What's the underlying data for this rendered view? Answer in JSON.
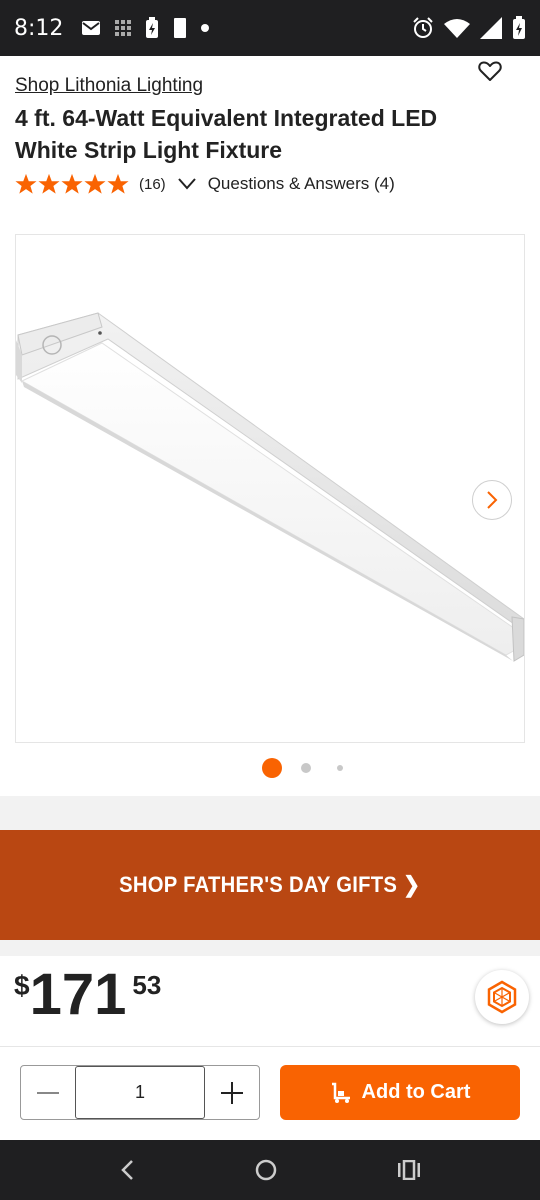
{
  "status_bar": {
    "time": "8:12",
    "left_icons": [
      "mail-icon",
      "grid-icon",
      "battery-saver-icon",
      "sd-card-icon",
      "dot-icon"
    ],
    "right_icons": [
      "alarm-icon",
      "wifi-icon",
      "signal-icon",
      "battery-icon"
    ]
  },
  "product": {
    "brand_link": "Shop Lithonia Lighting",
    "title": "4 ft. 64-Watt Equivalent Integrated LED White Strip Light Fixture",
    "rating": 5,
    "review_count": "(16)",
    "qa_label": "Questions & Answers (4)"
  },
  "gallery": {
    "image_count": 3,
    "active_index": 0
  },
  "promo": {
    "label": "SHOP FATHER'S DAY GIFTS ❯"
  },
  "price": {
    "currency": "$",
    "dollars": "171",
    "cents": "53"
  },
  "cart": {
    "quantity": "1",
    "add_label": "Add to Cart"
  },
  "colors": {
    "accent": "#f96302",
    "promo_bg": "#b94712",
    "system_bar": "#1f1f21"
  }
}
